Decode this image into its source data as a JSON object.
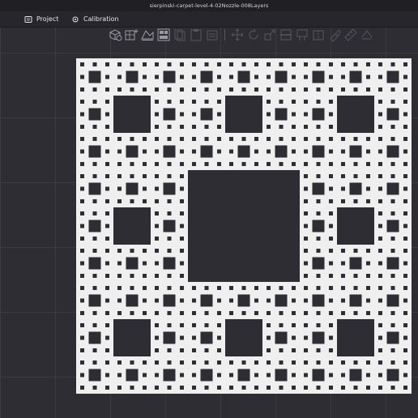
{
  "window": {
    "title": "sierpinski-carpet-level-4-02Nozzle-008Layers"
  },
  "tabs": [
    {
      "label": "Project",
      "icon": "project-icon"
    },
    {
      "label": "Calibration",
      "icon": "calibration-icon"
    }
  ],
  "toolbar": {
    "buttons_enabled": [
      "add-object-icon",
      "add-plate-icon",
      "auto-orient-icon",
      "arrange-icon"
    ],
    "buttons_disabled": [
      "copy-icon",
      "paste-icon",
      "delete-icon",
      "move-icon",
      "rotate-icon",
      "scale-icon",
      "cut-icon",
      "support-paint-icon",
      "seam-paint-icon",
      "color-paint-icon",
      "measure-icon",
      "assembly-icon"
    ]
  },
  "model": {
    "name": "sierpinski-carpet",
    "level": 4,
    "fill_color": "#efefef",
    "hole_color": "#2d2d33"
  },
  "colors": {
    "background": "#2b2b31",
    "titlebar": "#1f1f24",
    "text": "#e6e6ea"
  }
}
